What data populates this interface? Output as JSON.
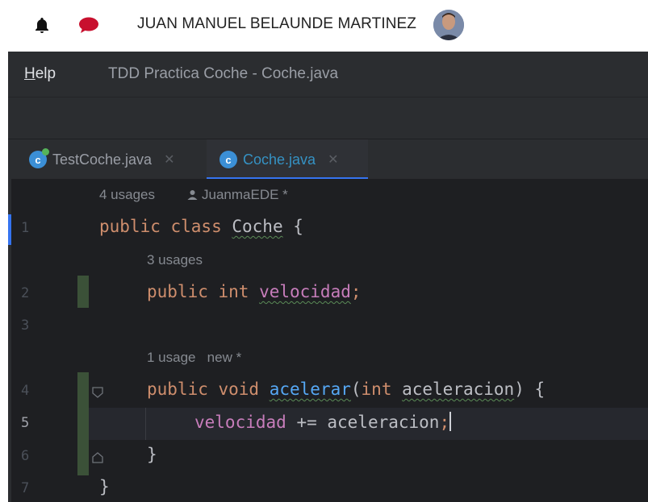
{
  "header": {
    "user_name": "JUAN MANUEL BELAUNDE MARTINEZ",
    "icons": [
      "bell-icon",
      "chat-icon",
      "avatar"
    ]
  },
  "ide": {
    "menu": {
      "help_prefix": "H",
      "help_rest": "elp"
    },
    "window_title": "TDD Practica Coche - Coche.java",
    "tabs": [
      {
        "label": "TestCoche.java",
        "icon": "c",
        "active": false
      },
      {
        "label": "Coche.java",
        "icon": "c",
        "active": true
      }
    ],
    "line_numbers": [
      "1",
      "2",
      "3",
      "4",
      "5",
      "6",
      "7"
    ],
    "hints": {
      "class_usages": "4 usages",
      "class_author": "JuanmaEDE *",
      "field_usages": "3 usages",
      "method_usages": "1 usage",
      "method_new": "new *"
    },
    "code": {
      "l1_kw": "public class ",
      "l1_name": "Coche",
      "l1_end": " {",
      "l2_kw": "public int ",
      "l2_field": "velocidad",
      "l2_end": ";",
      "l4_kw": "public void ",
      "l4_fn": "acelerar",
      "l4_open": "(",
      "l4_kw2": "int ",
      "l4_param": "aceleracion",
      "l4_end": ") {",
      "l5_field": "velocidad",
      "l5_op": " += ",
      "l5_var": "aceleracion",
      "l5_semi": ";",
      "l6": "}",
      "l7": "}"
    },
    "colors": {
      "keyword": "#cf8e6d",
      "field": "#c77dbb",
      "function": "#56a8f5",
      "text": "#bcbec4",
      "accent": "#3574f0"
    }
  }
}
